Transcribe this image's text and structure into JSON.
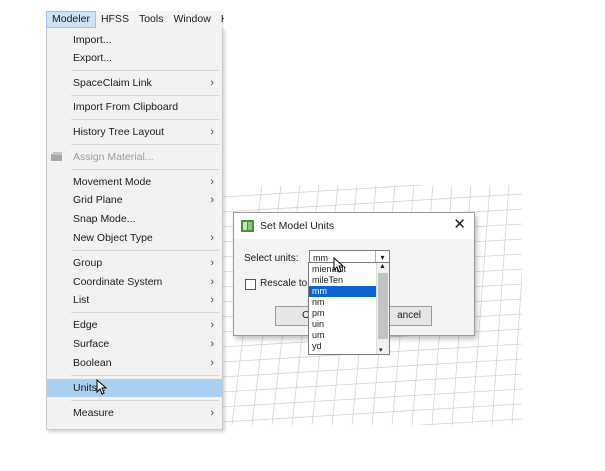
{
  "menubar": {
    "items": [
      "Modeler",
      "HFSS",
      "Tools",
      "Window",
      "H"
    ]
  },
  "menu": {
    "items": [
      {
        "label": "Import...",
        "arrow": ""
      },
      {
        "label": "Export...",
        "arrow": ""
      },
      {
        "label": "SpaceClaim Link",
        "arrow": "›"
      },
      {
        "label": "Import From Clipboard",
        "arrow": ""
      },
      {
        "label": "History Tree Layout",
        "arrow": "›"
      },
      {
        "label": "Assign Material...",
        "arrow": ""
      },
      {
        "label": "Movement Mode",
        "arrow": "›"
      },
      {
        "label": "Grid Plane",
        "arrow": "›"
      },
      {
        "label": "Snap Mode...",
        "arrow": ""
      },
      {
        "label": "New Object Type",
        "arrow": "›"
      },
      {
        "label": "Group",
        "arrow": "›"
      },
      {
        "label": "Coordinate System",
        "arrow": "›"
      },
      {
        "label": "List",
        "arrow": "›"
      },
      {
        "label": "Edge",
        "arrow": "›"
      },
      {
        "label": "Surface",
        "arrow": "›"
      },
      {
        "label": "Boolean",
        "arrow": "›"
      },
      {
        "label": "Units...",
        "arrow": ""
      },
      {
        "label": "Measure",
        "arrow": "›"
      }
    ]
  },
  "dialog": {
    "title": "Set Model Units",
    "close": "✕",
    "select_label": "Select units:",
    "selected_unit": "mm",
    "rescale_label": "Rescale to m",
    "ok": "O",
    "cancel": "ancel"
  },
  "dropdown": {
    "options": [
      "mienaidt",
      "mileTen",
      "mm",
      "nm",
      "pm",
      "uin",
      "um",
      "yd"
    ],
    "selected": "mm"
  },
  "icons": {
    "dropdown_arrow": "▾",
    "scroll_up": "▲",
    "scroll_down": "▾"
  },
  "colors": {
    "highlight": "#a7d0f3",
    "selection": "#0a64d4"
  }
}
